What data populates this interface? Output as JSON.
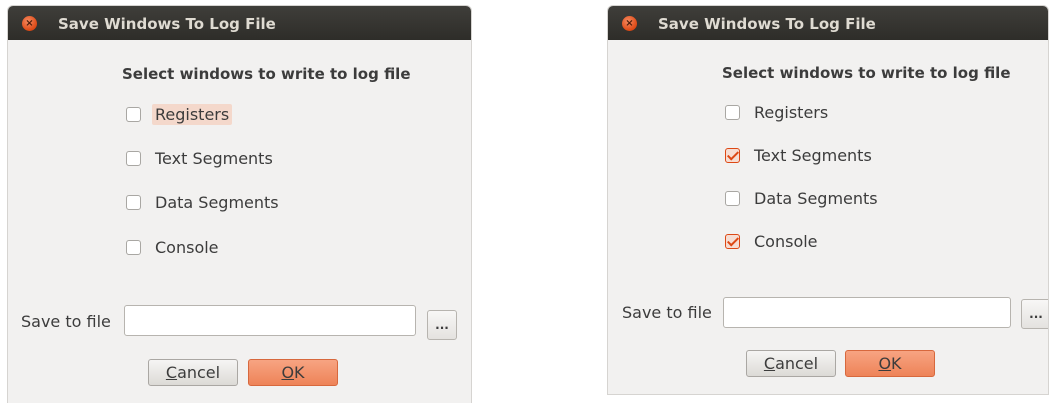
{
  "dialogs": [
    {
      "title": "Save Windows To Log File",
      "header": "Select windows to write to log file",
      "options": [
        {
          "label": "Registers",
          "checked": false,
          "focused": true
        },
        {
          "label": "Text Segments",
          "checked": false,
          "focused": false
        },
        {
          "label": "Data Segments",
          "checked": false,
          "focused": false
        },
        {
          "label": "Console",
          "checked": false,
          "focused": false
        }
      ],
      "file_label": "Save to file",
      "file_value": "",
      "browse_label": "...",
      "cancel_mnemonic": "C",
      "cancel_rest": "ancel",
      "ok_mnemonic": "O",
      "ok_rest": "K"
    },
    {
      "title": "Save Windows To Log File",
      "header": "Select windows to write to log file",
      "options": [
        {
          "label": "Registers",
          "checked": false,
          "focused": false
        },
        {
          "label": "Text Segments",
          "checked": true,
          "focused": false
        },
        {
          "label": "Data Segments",
          "checked": false,
          "focused": false
        },
        {
          "label": "Console",
          "checked": true,
          "focused": false
        }
      ],
      "file_label": "Save to file",
      "file_value": "",
      "browse_label": "...",
      "cancel_mnemonic": "C",
      "cancel_rest": "ancel",
      "ok_mnemonic": "O",
      "ok_rest": "K"
    }
  ],
  "colors": {
    "titlebar": "#3c3b37",
    "accent": "#dd4814",
    "ok_button": "#f08f66",
    "dialog_bg": "#f2f1f0"
  }
}
